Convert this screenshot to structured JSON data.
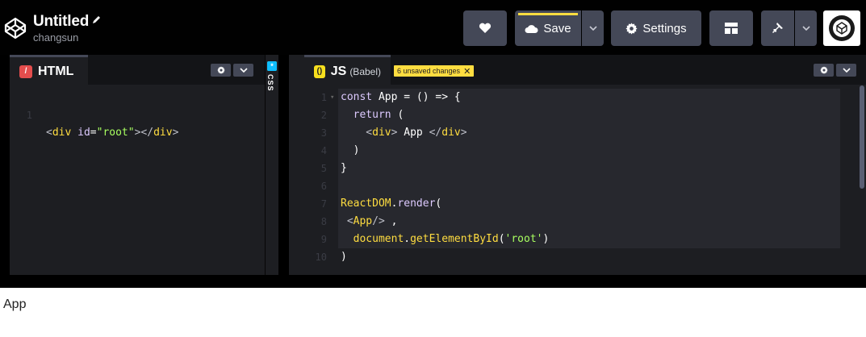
{
  "header": {
    "title": "Untitled",
    "author": "changsun",
    "save_label": "Save",
    "settings_label": "Settings"
  },
  "html_editor": {
    "tab_label": "HTML",
    "lines": [
      {
        "n": "1",
        "code": "<div id=\"root\"></div>"
      }
    ]
  },
  "css_editor": {
    "tab_label": "CSS"
  },
  "js_editor": {
    "tab_label": "JS",
    "tab_sub": "(Babel)",
    "unsaved": "6 unsaved changes",
    "line_numbers": [
      "1",
      "2",
      "3",
      "4",
      "5",
      "6",
      "7",
      "8",
      "9",
      "10"
    ],
    "lines": [
      "const App = () => {",
      "  return (",
      "    <div> App </div>",
      "  )",
      "}",
      "",
      "ReactDOM.render(",
      " <App/> ,",
      "  document.getElementById('root')",
      ")"
    ]
  },
  "result": {
    "text": "App"
  },
  "colors": {
    "accent_yellow": "#ffdd40",
    "header_bg": "#010101",
    "button_bg": "#444857",
    "editor_bg": "#1d1e22"
  },
  "icons": [
    "codepen-logo-icon",
    "pencil-icon",
    "heart-icon",
    "cloud-icon",
    "chevron-down-icon",
    "gear-icon",
    "layout-icon",
    "pin-icon",
    "avatar"
  ]
}
